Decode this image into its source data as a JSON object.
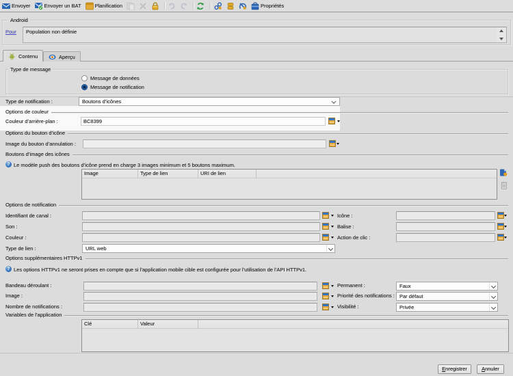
{
  "colors": {
    "window_bg": "#efefef",
    "accent_blue": "#2f6db8",
    "gold": "#dfa32a",
    "link": "#4a47c6",
    "white_panel": "#fdfdfd"
  },
  "toolbar": {
    "send_label": "Envoyer",
    "send_proof_label": "Envoyer un BAT",
    "schedule_label": "Planification",
    "properties_label": "Propriétés"
  },
  "android": {
    "legend": "Android",
    "to_label": "Pour",
    "population_value": "Population non définie"
  },
  "tabs": [
    {
      "label": "Contenu"
    },
    {
      "label": "Aperçu"
    }
  ],
  "form": {
    "message_type": {
      "legend": "Type de message",
      "radios": [
        {
          "label": "Message de données",
          "selected": false
        },
        {
          "label": "Message de notification",
          "selected": true
        }
      ]
    },
    "notification_type": {
      "label": "Type de notification :",
      "value": "Boutons d’icônes"
    },
    "color_options": {
      "legend": "Options de couleur",
      "background_color": {
        "label": "Couleur d’arrière-plan :",
        "value": "BC8399"
      }
    },
    "icon_button_options": {
      "legend": "Options du bouton d’icône",
      "cancel_image": {
        "label": "Image du bouton d’annulation :",
        "value": ""
      }
    },
    "icon_image_buttons": {
      "legend": "Boutons d’image des icônes",
      "info": "Le modèle push des boutons d’icône prend en charge 3 images minimum et 5 boutons maximum.",
      "table": {
        "columns": [
          "Image",
          "Type de lien",
          "URI de lien"
        ],
        "rows": []
      }
    },
    "notification_options": {
      "legend": "Options de notification",
      "left": [
        {
          "label": "Identifiant de canal :",
          "value": ""
        },
        {
          "label": "Son :",
          "value": ""
        },
        {
          "label": "Couleur :",
          "value": ""
        }
      ],
      "link_type": {
        "label": "Type de lien :",
        "value": "URL web"
      },
      "right": [
        {
          "label": "Icône :",
          "value": ""
        },
        {
          "label": "Balise :",
          "value": ""
        },
        {
          "label": "Action de clic :",
          "value": ""
        }
      ]
    },
    "httpv1_options": {
      "legend": "Options supplémentaires HTTPv1",
      "info": "Les options HTTPv1 ne seront prises en compte que si l’application mobile cible est configurée pour l’utilisation de l’API HTTPv1.",
      "left": [
        {
          "label": "Bandeau déroulant :",
          "value": ""
        },
        {
          "label": "Image :",
          "value": ""
        },
        {
          "label": "Nombre de notifications :",
          "value": ""
        }
      ],
      "right": [
        {
          "label": "Permanent :",
          "value": "Faux"
        },
        {
          "label": "Priorité des notifications :",
          "value": "Par défaut"
        },
        {
          "label": "Visibilité :",
          "value": "Privée"
        }
      ]
    },
    "app_variables": {
      "legend": "Variables de l’application",
      "table": {
        "columns": [
          "Clé",
          "Valeur"
        ],
        "rows": []
      }
    }
  },
  "footer": {
    "save_label": "Enregistrer",
    "cancel_label": "Annuler"
  }
}
